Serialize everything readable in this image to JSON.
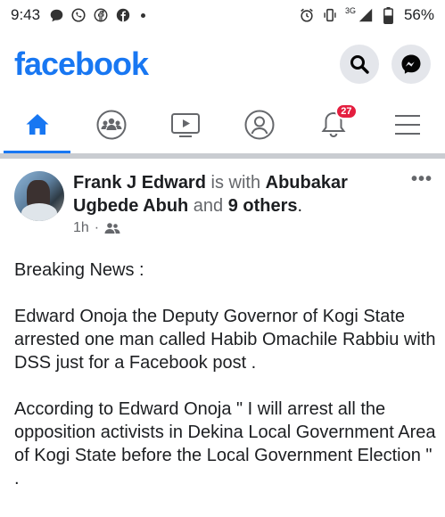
{
  "status_bar": {
    "time": "9:43",
    "network": "3G",
    "battery": "56%"
  },
  "header": {
    "logo": "facebook",
    "brand_color": "#1877f2"
  },
  "nav": {
    "notification_count": "27",
    "tabs": [
      "home-icon",
      "groups-icon",
      "watch-icon",
      "profile-icon",
      "notifications-icon",
      "menu-icon"
    ]
  },
  "post": {
    "author": "Frank J Edward",
    "with_text": " is with ",
    "tagged": "Abubakar Ugbede Abuh",
    "and_text": " and ",
    "others": "9 others",
    "period": ".",
    "time": "1h",
    "separator": "·",
    "more": "•••",
    "paragraphs": [
      "Breaking News :",
      "Edward Onoja the Deputy Governor of Kogi State  arrested one man called Habib Omachile Rabbiu with DSS just for a Facebook post .",
      "According to Edward Onoja \" I will arrest all the opposition activists in Dekina Local Government Area of Kogi State before the Local Government Election \" ."
    ]
  }
}
